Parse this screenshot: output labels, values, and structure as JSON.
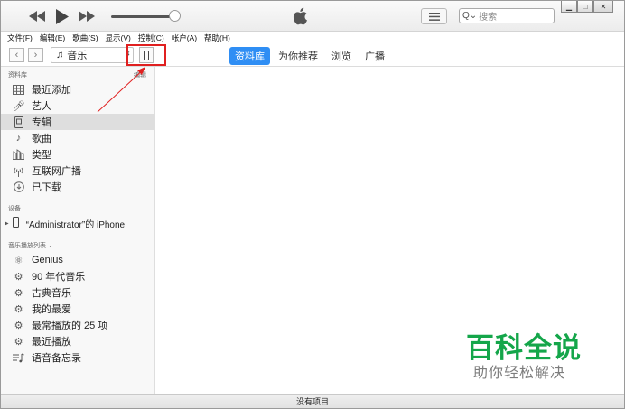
{
  "player": {
    "search_placeholder": "搜索"
  },
  "menu": [
    "文件(F)",
    "编辑(E)",
    "歌曲(S)",
    "显示(V)",
    "控制(C)",
    "帐户(A)",
    "帮助(H)"
  ],
  "toolbar": {
    "media_label": "音乐",
    "tabs": [
      "资料库",
      "为你推荐",
      "浏览",
      "广播"
    ],
    "active_tab": "资料库"
  },
  "sidebar": {
    "library_title": "资料库",
    "edit_label": "编辑",
    "library_items": [
      {
        "label": "最近添加",
        "icon": "grid-icon"
      },
      {
        "label": "艺人",
        "icon": "microphone-icon"
      },
      {
        "label": "专辑",
        "icon": "album-icon"
      },
      {
        "label": "歌曲",
        "icon": "music-note-icon"
      },
      {
        "label": "类型",
        "icon": "genre-icon"
      },
      {
        "label": "互联网广播",
        "icon": "radio-antenna-icon"
      },
      {
        "label": "已下载",
        "icon": "download-icon"
      }
    ],
    "selected_item": "专辑",
    "devices_title": "设备",
    "device_name": "“Administrator”的 iPhone",
    "playlists_title": "音乐播放列表",
    "playlist_items": [
      {
        "label": "Genius",
        "icon": "genius-icon"
      },
      {
        "label": "90 年代音乐",
        "icon": "gear-icon"
      },
      {
        "label": "古典音乐",
        "icon": "gear-icon"
      },
      {
        "label": "我的最爱",
        "icon": "gear-icon"
      },
      {
        "label": "最常播放的 25 项",
        "icon": "gear-icon"
      },
      {
        "label": "最近播放",
        "icon": "gear-icon"
      },
      {
        "label": "语音备忘录",
        "icon": "playlist-icon"
      }
    ]
  },
  "status_bar": {
    "text": "没有项目"
  },
  "watermark": {
    "main": "百科全说",
    "sub": "助你轻松解决"
  },
  "colors": {
    "accent": "#2f8ef4",
    "highlight": "#e02020",
    "watermark": "#14a64a"
  }
}
